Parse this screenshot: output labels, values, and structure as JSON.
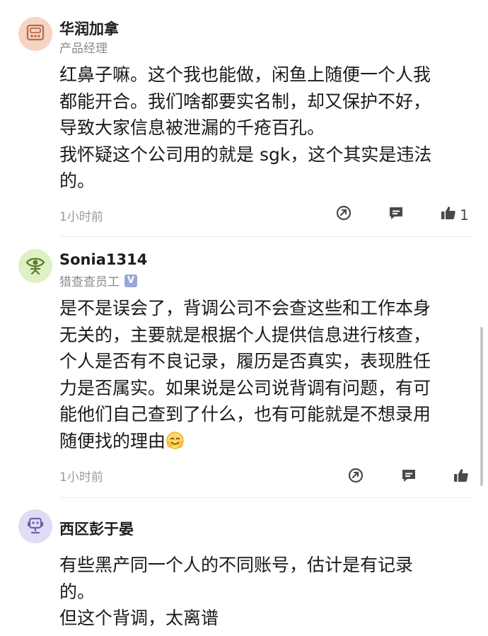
{
  "comments": [
    {
      "name": "华润加拿",
      "role": "产品经理",
      "avatar_icon": "cassette-robot-icon",
      "lines": [
        "红鼻子嘛。这个我也能做，闲鱼上随便一个人我",
        "都能开合。我们啥都要实名制，却又保护不好，",
        "导致大家信息被泄漏的千疮百孔。",
        "我怀疑这个公司用的就是 sgk，这个其实是违法",
        "的。"
      ],
      "time": "1小时前",
      "like_count": "1"
    },
    {
      "name": "Sonia1314",
      "role": "猎查查员工",
      "badge": "V",
      "avatar_icon": "eye-figure-icon",
      "lines": [
        "是不是误会了，背调公司不会查这些和工作本身",
        "无关的，主要就是根据个人提供信息进行核查，",
        "个人是否有不良记录，履历是否真实，表现胜任",
        "力是否属实。如果说是公司说背调有问题，有可",
        "能他们自己查到了什么，也有可能就是不想录用",
        "随便找的理由"
      ],
      "emoji": "smiling-face-emoji",
      "time": "1小时前"
    },
    {
      "name": "西区彭于晏",
      "avatar_icon": "robot-face-icon",
      "lines": [
        "有些黑产同一个人的不同账号，估计是有记录",
        "的。",
        "但这个背调，太离谱"
      ]
    }
  ],
  "colors": {
    "accent_badge": "#9aa6d8",
    "text_secondary": "#8a8a8a"
  }
}
